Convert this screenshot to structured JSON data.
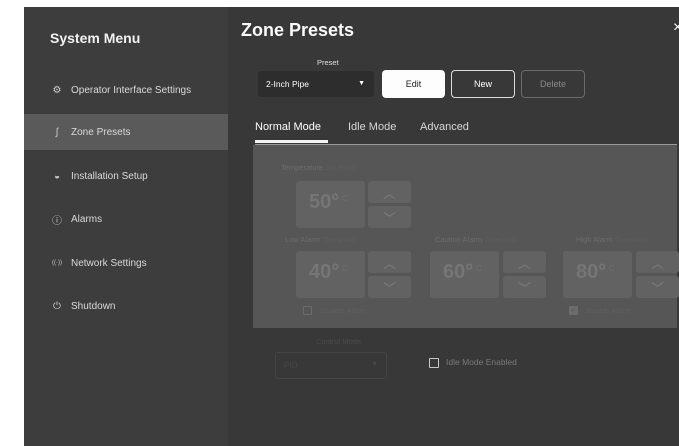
{
  "sidebar": {
    "title": "System Menu",
    "items": [
      {
        "label": "Operator Interface Settings",
        "icon": "gear-icon",
        "glyph": "⚙"
      },
      {
        "label": "Zone Presets",
        "icon": "pipe-icon",
        "glyph": "∫"
      },
      {
        "label": "Installation Setup",
        "icon": "installation-icon",
        "glyph": "◒"
      },
      {
        "label": "Alarms",
        "icon": "alert-circle-icon",
        "glyph": "ⓘ"
      },
      {
        "label": "Network Settings",
        "icon": "wireless-icon",
        "glyph": "((·))"
      },
      {
        "label": "Shutdown",
        "icon": "power-icon",
        "glyph": "⏻"
      }
    ],
    "active_item": "Zone Presets"
  },
  "main": {
    "title": "Zone Presets",
    "close_glyph": "×",
    "preset": {
      "caption": "Preset",
      "value": "2-Inch Pipe",
      "caret": "▼"
    },
    "buttons": {
      "edit": "Edit",
      "new": "New",
      "delete": "Delete"
    },
    "tabs": [
      {
        "label": "Normal Mode",
        "active": true
      },
      {
        "label": "Idle Mode",
        "active": false
      },
      {
        "label": "Advanced",
        "active": false
      }
    ],
    "fields": {
      "temperature": {
        "label": "Temperature",
        "sub": "Set Point",
        "value": "50°",
        "unit": "C"
      },
      "low_alarm": {
        "label": "Low Alarm",
        "sub": "Threshold",
        "value": "40°",
        "unit": "C"
      },
      "caution_alarm": {
        "label": "Caution Alarm",
        "sub": "Threshold",
        "value": "60°",
        "unit": "C"
      },
      "high_alarm": {
        "label": "High Alarm",
        "sub": "Threshold",
        "value": "80°",
        "unit": "C"
      }
    },
    "arrow_up": "︿",
    "arrow_down": "﹀",
    "low_alarm_checkbox": {
      "checked": false,
      "label": "Disable Alarm"
    },
    "high_alarm_checkbox": {
      "checked": true,
      "label": "Enable Alarm",
      "check_glyph": "✓"
    },
    "control_mode": {
      "caption": "Control Mode",
      "value": "PID",
      "caret": "▼"
    },
    "idle_mode": {
      "label": "Idle Mode Enabled",
      "checked": false
    }
  },
  "colors": {
    "sidebar_bg": "#3d3d3d",
    "sidebar_active": "#5a5a5a",
    "main_bg": "#383838",
    "panel_bg": "#565656",
    "accent": "#ffffff"
  }
}
